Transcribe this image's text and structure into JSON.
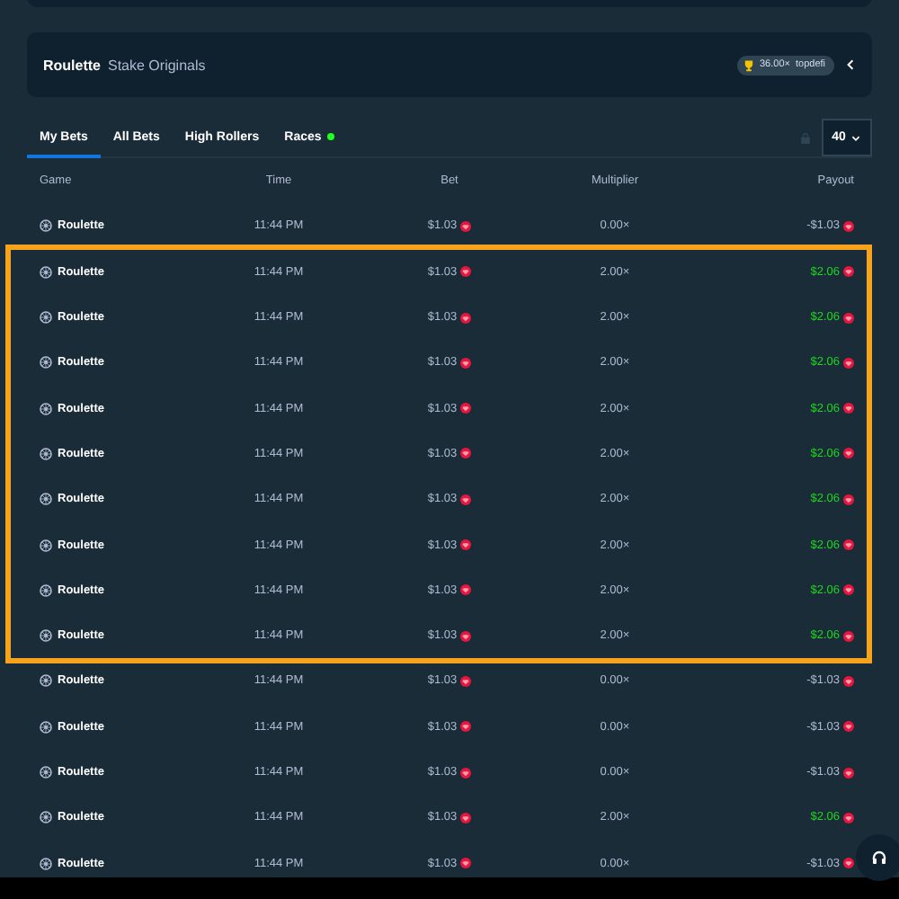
{
  "game_bar": {
    "title": "Roulette",
    "subtitle": "Stake Originals",
    "record": {
      "multiplier": "36.00×",
      "user": "topdefi"
    }
  },
  "tabs": [
    {
      "label": "My Bets",
      "selected": true,
      "live": false
    },
    {
      "label": "All Bets",
      "selected": false,
      "live": false
    },
    {
      "label": "High Rollers",
      "selected": false,
      "live": false
    },
    {
      "label": "Races",
      "selected": false,
      "live": true
    }
  ],
  "page_size": "40",
  "columns": [
    "Game",
    "Time",
    "Bet",
    "Multiplier",
    "Payout"
  ],
  "rows": [
    {
      "game": "Roulette",
      "time": "11:44 PM",
      "bet": "$1.03",
      "multiplier": "0.00×",
      "payout": "-$1.03",
      "won": false,
      "highlighted": false
    },
    {
      "game": "Roulette",
      "time": "11:44 PM",
      "bet": "$1.03",
      "multiplier": "2.00×",
      "payout": "$2.06",
      "won": true,
      "highlighted": true
    },
    {
      "game": "Roulette",
      "time": "11:44 PM",
      "bet": "$1.03",
      "multiplier": "2.00×",
      "payout": "$2.06",
      "won": true,
      "highlighted": true
    },
    {
      "game": "Roulette",
      "time": "11:44 PM",
      "bet": "$1.03",
      "multiplier": "2.00×",
      "payout": "$2.06",
      "won": true,
      "highlighted": true
    },
    {
      "game": "Roulette",
      "time": "11:44 PM",
      "bet": "$1.03",
      "multiplier": "2.00×",
      "payout": "$2.06",
      "won": true,
      "highlighted": true
    },
    {
      "game": "Roulette",
      "time": "11:44 PM",
      "bet": "$1.03",
      "multiplier": "2.00×",
      "payout": "$2.06",
      "won": true,
      "highlighted": true
    },
    {
      "game": "Roulette",
      "time": "11:44 PM",
      "bet": "$1.03",
      "multiplier": "2.00×",
      "payout": "$2.06",
      "won": true,
      "highlighted": true
    },
    {
      "game": "Roulette",
      "time": "11:44 PM",
      "bet": "$1.03",
      "multiplier": "2.00×",
      "payout": "$2.06",
      "won": true,
      "highlighted": true
    },
    {
      "game": "Roulette",
      "time": "11:44 PM",
      "bet": "$1.03",
      "multiplier": "2.00×",
      "payout": "$2.06",
      "won": true,
      "highlighted": true
    },
    {
      "game": "Roulette",
      "time": "11:44 PM",
      "bet": "$1.03",
      "multiplier": "2.00×",
      "payout": "$2.06",
      "won": true,
      "highlighted": true
    },
    {
      "game": "Roulette",
      "time": "11:44 PM",
      "bet": "$1.03",
      "multiplier": "0.00×",
      "payout": "-$1.03",
      "won": false,
      "highlighted": false
    },
    {
      "game": "Roulette",
      "time": "11:44 PM",
      "bet": "$1.03",
      "multiplier": "0.00×",
      "payout": "-$1.03",
      "won": false,
      "highlighted": false
    },
    {
      "game": "Roulette",
      "time": "11:44 PM",
      "bet": "$1.03",
      "multiplier": "0.00×",
      "payout": "-$1.03",
      "won": false,
      "highlighted": false
    },
    {
      "game": "Roulette",
      "time": "11:44 PM",
      "bet": "$1.03",
      "multiplier": "2.00×",
      "payout": "$2.06",
      "won": true,
      "highlighted": false
    },
    {
      "game": "Roulette",
      "time": "11:44 PM",
      "bet": "$1.03",
      "multiplier": "0.00×",
      "payout": "-$1.03",
      "won": false,
      "highlighted": false
    }
  ]
}
